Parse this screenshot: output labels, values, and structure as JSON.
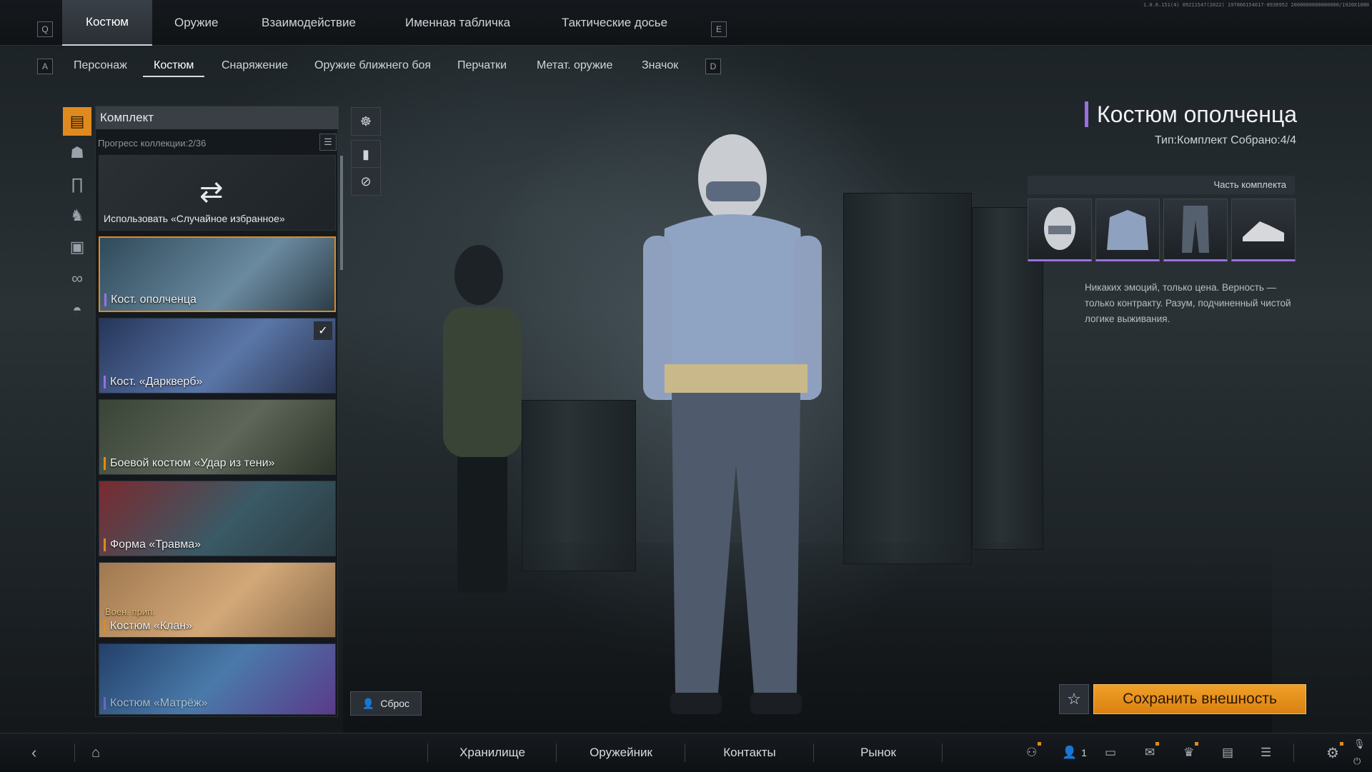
{
  "version": "1.0.0.151(4) 09211547(2022) 197006154017-8936952 2000000000000000/1920X1080",
  "top_tabs": {
    "key_left": "Q",
    "key_right": "E",
    "items": [
      {
        "label": "Костюм",
        "active": true
      },
      {
        "label": "Оружие"
      },
      {
        "label": "Взаимодействие"
      },
      {
        "label": "Именная табличка"
      },
      {
        "label": "Тактические досье"
      }
    ]
  },
  "sub_tabs": {
    "key_left": "A",
    "key_right": "D",
    "items": [
      {
        "label": "Персонаж"
      },
      {
        "label": "Костюм",
        "active": true
      },
      {
        "label": "Снаряжение"
      },
      {
        "label": "Оружие ближнего боя"
      },
      {
        "label": "Перчатки"
      },
      {
        "label": "Метат. оружие"
      },
      {
        "label": "Значок"
      }
    ]
  },
  "categories": [
    "set-icon",
    "helmet-icon",
    "pants-icon",
    "boots-icon",
    "vest-icon",
    "glasses-icon",
    "cap-icon"
  ],
  "panel": {
    "title": "Комплект",
    "progress": "Прогресс коллекции:2/36",
    "random_label": "Использовать «Случайное избранное»",
    "cards": [
      {
        "label": "Кост. ополченца",
        "selected": true
      },
      {
        "label": "Кост. «Даркверб»",
        "equipped": true
      },
      {
        "label": "Боевой костюм «Удар из тени»"
      },
      {
        "label": "Форма «Травма»"
      },
      {
        "label": "Костюм «Клан»",
        "sub": "Воен. прип."
      },
      {
        "label": "Костюм «Матрёж»"
      }
    ]
  },
  "reset_label": "Сброс",
  "info": {
    "title": "Костюм ополченца",
    "meta": "Тип:Комплект Собрано:4/4",
    "set_header": "Часть комплекта",
    "pieces": [
      "balaclava-icon",
      "jacket-icon",
      "trousers-icon",
      "sneakers-icon"
    ],
    "description": "Никаких эмоций, только цена. Верность — только контракту. Разум, подчиненный чистой логике выживания."
  },
  "save_label": "Сохранить внешность",
  "bottom": {
    "nav": [
      "Хранилище",
      "Оружейник",
      "Контакты",
      "Рынок"
    ],
    "party_count": "1"
  },
  "colors": {
    "accent": "#e08a1e",
    "rarity": "#9b6ee0"
  }
}
